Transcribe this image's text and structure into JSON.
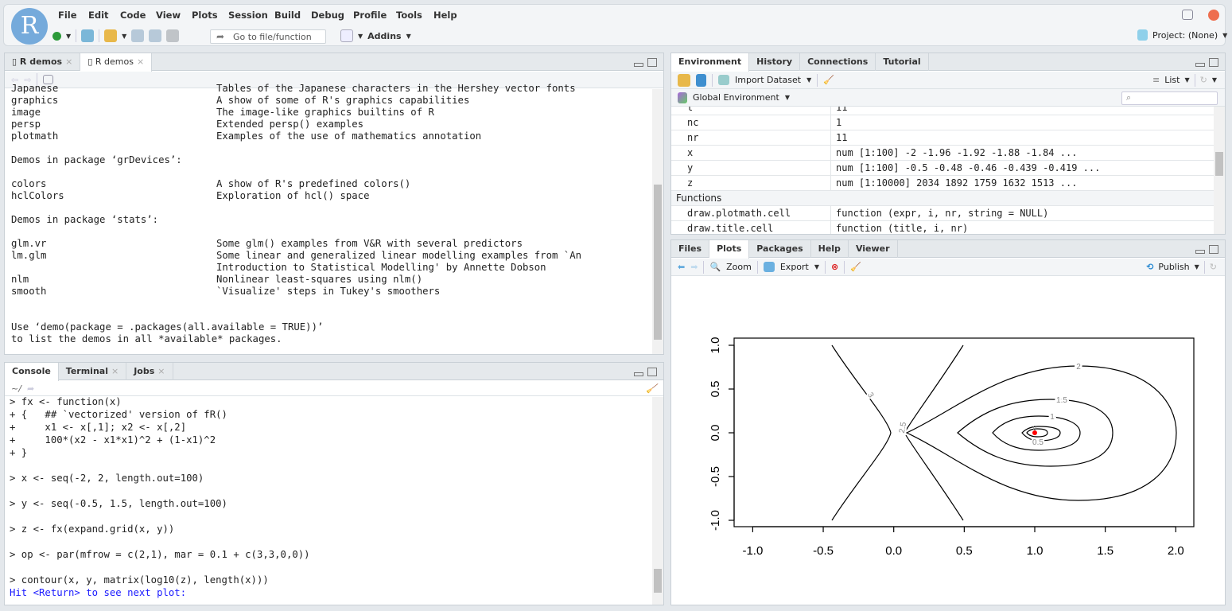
{
  "app": {
    "logo": "R",
    "menu": [
      "File",
      "Edit",
      "Code",
      "View",
      "Plots",
      "Session",
      "Build",
      "Debug",
      "Profile",
      "Tools",
      "Help"
    ],
    "goto_placeholder": "Go to file/function",
    "addins": "Addins",
    "project": "Project: (None)"
  },
  "editor": {
    "tabs": [
      "R demos",
      "R demos"
    ],
    "lines": [
      {
        "n": "Japanese",
        "d": "Tables of the Japanese characters in the Hershey vector fonts"
      },
      {
        "n": "graphics",
        "d": "A show of some of R's graphics capabilities"
      },
      {
        "n": "image",
        "d": "The image-like graphics builtins of R"
      },
      {
        "n": "persp",
        "d": "Extended persp() examples"
      },
      {
        "n": "plotmath",
        "d": "Examples of the use of mathematics annotation"
      },
      {
        "n": "",
        "d": ""
      },
      {
        "n": "Demos in package ‘grDevices’:",
        "d": ""
      },
      {
        "n": "",
        "d": ""
      },
      {
        "n": "colors",
        "d": "A show of R's predefined colors()"
      },
      {
        "n": "hclColors",
        "d": "Exploration of hcl() space"
      },
      {
        "n": "",
        "d": ""
      },
      {
        "n": "Demos in package ‘stats’:",
        "d": ""
      },
      {
        "n": "",
        "d": ""
      },
      {
        "n": "glm.vr",
        "d": "Some glm() examples from V&R with several predictors"
      },
      {
        "n": "lm.glm",
        "d": "Some linear and generalized linear modelling examples from `An"
      },
      {
        "n": "",
        "d": "Introduction to Statistical Modelling' by Annette Dobson"
      },
      {
        "n": "nlm",
        "d": "Nonlinear least-squares using nlm()"
      },
      {
        "n": "smooth",
        "d": "`Visualize' steps in Tukey's smoothers"
      },
      {
        "n": "",
        "d": ""
      },
      {
        "n": "",
        "d": ""
      },
      {
        "n": "Use ‘demo(package = .packages(all.available = TRUE))’",
        "d": ""
      },
      {
        "n": "to list the demos in all *available* packages.",
        "d": ""
      }
    ]
  },
  "console": {
    "tabs": [
      "Console",
      "Terminal",
      "Jobs"
    ],
    "path": "~/",
    "lines": [
      "> fx <- function(x)",
      "+ {   ## `vectorized' version of fR()",
      "+     x1 <- x[,1]; x2 <- x[,2]",
      "+     100*(x2 - x1*x1)^2 + (1-x1)^2",
      "+ }",
      "",
      "> x <- seq(-2, 2, length.out=100)",
      "",
      "> y <- seq(-0.5, 1.5, length.out=100)",
      "",
      "> z <- fx(expand.grid(x, y))",
      "",
      "> op <- par(mfrow = c(2,1), mar = 0.1 + c(3,3,0,0))",
      "",
      "> contour(x, y, matrix(log10(z), length(x)))"
    ],
    "prompt_msg": "Hit <Return> to see next plot:"
  },
  "environment": {
    "tabs": [
      "Environment",
      "History",
      "Connections",
      "Tutorial"
    ],
    "import": "Import Dataset",
    "view": "List",
    "scope": "Global Environment",
    "rows": [
      {
        "n": "t",
        "v": "11"
      },
      {
        "n": "nc",
        "v": "1"
      },
      {
        "n": "nr",
        "v": "11"
      },
      {
        "n": "x",
        "v": "num [1:100] -2 -1.96 -1.92 -1.88 -1.84 ..."
      },
      {
        "n": "y",
        "v": "num [1:100] -0.5 -0.48 -0.46 -0.439 -0.419 ..."
      },
      {
        "n": "z",
        "v": "num [1:10000] 2034 1892 1759 1632 1513 ..."
      }
    ],
    "functions_header": "Functions",
    "functions": [
      {
        "n": "draw.plotmath.cell",
        "v": "function (expr, i, nr, string = NULL)"
      },
      {
        "n": "draw.title.cell",
        "v": "function (title, i, nr)"
      }
    ]
  },
  "plots": {
    "tabs": [
      "Files",
      "Plots",
      "Packages",
      "Help",
      "Viewer"
    ],
    "zoom": "Zoom",
    "export": "Export",
    "publish": "Publish",
    "xticks": [
      "-1.0",
      "-0.5",
      "0.0",
      "0.5",
      "1.0",
      "1.5",
      "2.0"
    ],
    "yticks": [
      "-1.0",
      "-0.5",
      "0.0",
      "0.5",
      "1.0"
    ],
    "contour_labels": [
      "3",
      "2.5",
      "2",
      "1.5",
      "1",
      "0.5",
      "0"
    ],
    "point_color": "#ff0000"
  }
}
